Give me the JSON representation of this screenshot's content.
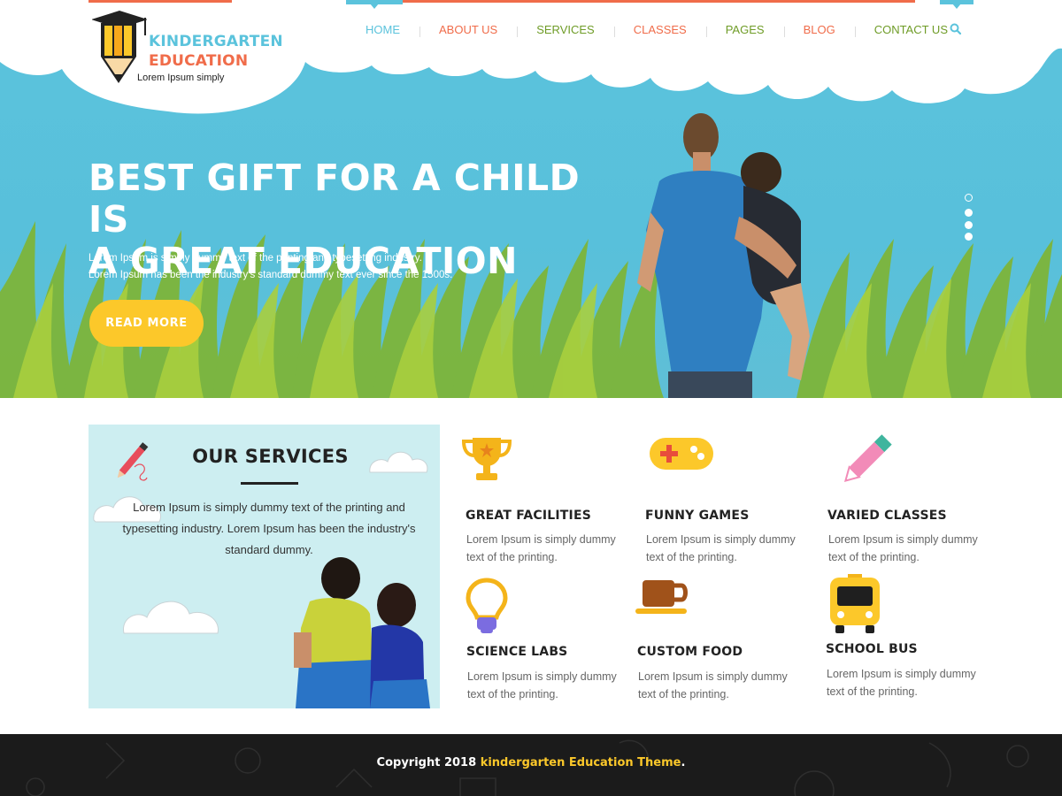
{
  "logo": {
    "line1": "KINDERGARTEN",
    "line2": "EDUCATION",
    "tagline": "Lorem Ipsum simply",
    "icon": "pencil-graduation-cap-icon"
  },
  "nav": {
    "items": [
      {
        "label": "HOME",
        "color": "#5bc3dc"
      },
      {
        "label": "ABOUT US",
        "color": "#f06c4a"
      },
      {
        "label": "SERVICES",
        "color": "#6f9c27"
      },
      {
        "label": "CLASSES",
        "color": "#f06c4a"
      },
      {
        "label": "PAGES",
        "color": "#6f9c27"
      },
      {
        "label": "BLOG",
        "color": "#f06c4a"
      },
      {
        "label": "CONTACT US",
        "color": "#6f9c27"
      }
    ],
    "search_icon": "search-icon"
  },
  "hero": {
    "title_line1": "BEST GIFT FOR A CHILD IS",
    "title_line2": "A GREAT EDUCATION",
    "text_line1": "Lorem Ipsum is simply dummy text of the printing and typesetting industry.",
    "text_line2": "Lorem Ipsum has been the industry's standard dummy text ever since the 1500s.",
    "button": "READ MORE"
  },
  "slider": {
    "active_index": 0,
    "count": 4
  },
  "services": {
    "title": "OUR SERVICES",
    "text": "Lorem Ipsum is simply dummy text of the printing and typesetting industry. Lorem Ipsum has been the industry's standard dummy."
  },
  "features": [
    {
      "title": "GREAT FACILITIES",
      "text": "Lorem Ipsum is simply dummy text of the printing.",
      "icon": "trophy-icon"
    },
    {
      "title": "FUNNY GAMES",
      "text": "Lorem Ipsum is simply dummy text of the printing.",
      "icon": "gamepad-icon"
    },
    {
      "title": "VARIED CLASSES",
      "text": "Lorem Ipsum is simply dummy text of the printing.",
      "icon": "pencil-icon"
    },
    {
      "title": "SCIENCE LABS",
      "text": "Lorem Ipsum is simply dummy text of the printing.",
      "icon": "lightbulb-icon"
    },
    {
      "title": "CUSTOM FOOD",
      "text": "Lorem Ipsum is simply dummy text of the printing.",
      "icon": "coffee-cup-icon"
    },
    {
      "title": "SCHOOL BUS",
      "text": "Lorem Ipsum is simply dummy text of the printing.",
      "icon": "bus-icon"
    }
  ],
  "footer": {
    "prefix": "Copyright 2018 ",
    "highlight": "kindergarten Education Theme",
    "suffix": "."
  },
  "colors": {
    "sky": "#5bc3dc",
    "accent_orange": "#f06c4a",
    "accent_green": "#6f9c27",
    "button_yellow": "#fcc82a",
    "footer_bg": "#1b1b1b"
  }
}
